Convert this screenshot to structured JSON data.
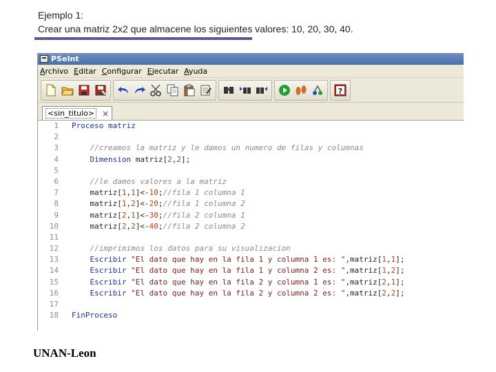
{
  "slide": {
    "title": "Ejemplo 1:",
    "subtitle_pre": "Crear una matriz ",
    "subtitle_dim": "2x2",
    "subtitle_mid": " que almacene los siguientes valores: ",
    "subtitle_vals": "10, 20, 30, 40",
    "subtitle_end": ".",
    "footer": "UNAN-Leon"
  },
  "window": {
    "title": "PSeInt",
    "menu": [
      "Archivo",
      "Editar",
      "Configurar",
      "Ejecutar",
      "Ayuda"
    ],
    "tab_label": "<sin_titulo>",
    "tab_close": "×"
  },
  "toolbar_icons": [
    "new-file-icon",
    "open-folder-icon",
    "save-icon",
    "save-as-icon",
    "undo-icon",
    "redo-icon",
    "cut-icon",
    "copy-icon",
    "paste-icon",
    "edit-icon",
    "search-icon",
    "search-prev-icon",
    "search-next-icon",
    "run-icon",
    "step-icon",
    "debug-icon",
    "help-icon"
  ],
  "code": {
    "lines": [
      {
        "n": "1",
        "parts": [
          {
            "t": "kw",
            "s": "Proceso matriz"
          }
        ]
      },
      {
        "n": "2",
        "parts": []
      },
      {
        "n": "3",
        "parts": [
          {
            "t": "plain",
            "s": "    "
          },
          {
            "t": "cm",
            "s": "//creamos la matriz y le damos un numero de filas y columnas"
          }
        ]
      },
      {
        "n": "4",
        "parts": [
          {
            "t": "plain",
            "s": "    "
          },
          {
            "t": "kw",
            "s": "Dimension"
          },
          {
            "t": "plain",
            "s": " matriz["
          },
          {
            "t": "num",
            "s": "2"
          },
          {
            "t": "plain",
            "s": ","
          },
          {
            "t": "num",
            "s": "2"
          },
          {
            "t": "plain",
            "s": "];"
          }
        ]
      },
      {
        "n": "5",
        "parts": []
      },
      {
        "n": "6",
        "parts": [
          {
            "t": "plain",
            "s": "    "
          },
          {
            "t": "cm",
            "s": "//le damos valores a la matriz"
          }
        ]
      },
      {
        "n": "7",
        "parts": [
          {
            "t": "plain",
            "s": "    matriz["
          },
          {
            "t": "num",
            "s": "1"
          },
          {
            "t": "plain",
            "s": ","
          },
          {
            "t": "num",
            "s": "1"
          },
          {
            "t": "plain",
            "s": "]<-"
          },
          {
            "t": "num",
            "s": "10"
          },
          {
            "t": "plain",
            "s": ";"
          },
          {
            "t": "cm",
            "s": "//fila 1 columna 1"
          }
        ]
      },
      {
        "n": "8",
        "parts": [
          {
            "t": "plain",
            "s": "    matriz["
          },
          {
            "t": "num",
            "s": "1"
          },
          {
            "t": "plain",
            "s": ","
          },
          {
            "t": "num",
            "s": "2"
          },
          {
            "t": "plain",
            "s": "]<-"
          },
          {
            "t": "num",
            "s": "20"
          },
          {
            "t": "plain",
            "s": ";"
          },
          {
            "t": "cm",
            "s": "//fila 1 columna 2"
          }
        ]
      },
      {
        "n": "9",
        "parts": [
          {
            "t": "plain",
            "s": "    matriz["
          },
          {
            "t": "num",
            "s": "2"
          },
          {
            "t": "plain",
            "s": ","
          },
          {
            "t": "num",
            "s": "1"
          },
          {
            "t": "plain",
            "s": "]<-"
          },
          {
            "t": "num",
            "s": "30"
          },
          {
            "t": "plain",
            "s": ";"
          },
          {
            "t": "cm",
            "s": "//fila 2 columna 1"
          }
        ]
      },
      {
        "n": "10",
        "parts": [
          {
            "t": "plain",
            "s": "    matriz["
          },
          {
            "t": "num",
            "s": "2"
          },
          {
            "t": "plain",
            "s": ","
          },
          {
            "t": "num",
            "s": "2"
          },
          {
            "t": "plain",
            "s": "]<-"
          },
          {
            "t": "num",
            "s": "40"
          },
          {
            "t": "plain",
            "s": ";"
          },
          {
            "t": "cm",
            "s": "//fila 2 columna 2"
          }
        ]
      },
      {
        "n": "11",
        "parts": []
      },
      {
        "n": "12",
        "parts": [
          {
            "t": "plain",
            "s": "    "
          },
          {
            "t": "cm",
            "s": "//imprimimos los datos para su visualizacion"
          }
        ]
      },
      {
        "n": "13",
        "parts": [
          {
            "t": "plain",
            "s": "    "
          },
          {
            "t": "kw",
            "s": "Escribir"
          },
          {
            "t": "plain",
            "s": " "
          },
          {
            "t": "str",
            "s": "\"El dato que hay en la fila 1 y columna 1 es: \""
          },
          {
            "t": "plain",
            "s": ",matriz["
          },
          {
            "t": "num",
            "s": "1"
          },
          {
            "t": "plain",
            "s": ","
          },
          {
            "t": "num",
            "s": "1"
          },
          {
            "t": "plain",
            "s": "];"
          }
        ]
      },
      {
        "n": "14",
        "parts": [
          {
            "t": "plain",
            "s": "    "
          },
          {
            "t": "kw",
            "s": "Escribir"
          },
          {
            "t": "plain",
            "s": " "
          },
          {
            "t": "str",
            "s": "\"El dato que hay en la fila 1 y columna 2 es: \""
          },
          {
            "t": "plain",
            "s": ",matriz["
          },
          {
            "t": "num",
            "s": "1"
          },
          {
            "t": "plain",
            "s": ","
          },
          {
            "t": "num",
            "s": "2"
          },
          {
            "t": "plain",
            "s": "];"
          }
        ]
      },
      {
        "n": "15",
        "parts": [
          {
            "t": "plain",
            "s": "    "
          },
          {
            "t": "kw",
            "s": "Escribir"
          },
          {
            "t": "plain",
            "s": " "
          },
          {
            "t": "str",
            "s": "\"El dato que hay en la fila 2 y columna 1 es: \""
          },
          {
            "t": "plain",
            "s": ",matriz["
          },
          {
            "t": "num",
            "s": "2"
          },
          {
            "t": "plain",
            "s": ","
          },
          {
            "t": "num",
            "s": "1"
          },
          {
            "t": "plain",
            "s": "];"
          }
        ]
      },
      {
        "n": "16",
        "parts": [
          {
            "t": "plain",
            "s": "    "
          },
          {
            "t": "kw",
            "s": "Escribir"
          },
          {
            "t": "plain",
            "s": " "
          },
          {
            "t": "str",
            "s": "\"El dato que hay en la fila 2 y columna 2 es: \""
          },
          {
            "t": "plain",
            "s": ",matriz["
          },
          {
            "t": "num",
            "s": "2"
          },
          {
            "t": "plain",
            "s": ","
          },
          {
            "t": "num",
            "s": "2"
          },
          {
            "t": "plain",
            "s": "];"
          }
        ]
      },
      {
        "n": "17",
        "parts": []
      },
      {
        "n": "18",
        "parts": [
          {
            "t": "kw",
            "s": "FinProceso"
          }
        ]
      }
    ]
  }
}
